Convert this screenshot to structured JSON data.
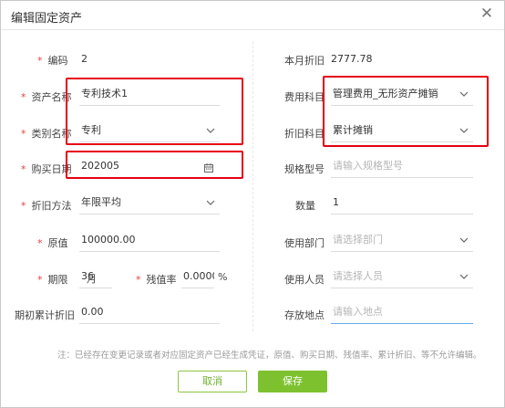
{
  "dialog": {
    "title": "编辑固定资产",
    "close_icon": "close-icon"
  },
  "left": {
    "code": {
      "label": "编码",
      "value": "2",
      "required": "*"
    },
    "asset_name": {
      "label": "资产名称",
      "value": "专利技术1",
      "required": "*"
    },
    "category": {
      "label": "类别名称",
      "value": "专利",
      "required": "*"
    },
    "purchase_date": {
      "label": "购买日期",
      "value": "202005",
      "required": "*"
    },
    "depreciation_method": {
      "label": "折旧方法",
      "value": "年限平均",
      "required": "*"
    },
    "original_value": {
      "label": "原值",
      "value": "100000.00",
      "required": "*"
    },
    "period": {
      "label": "期限",
      "value": "36",
      "unit": "月",
      "required": "*"
    },
    "residual_rate": {
      "label": "残值率",
      "value": "0.0000",
      "unit": "%",
      "required": "*"
    },
    "initial_accumulated": {
      "label": "期初累计折旧",
      "value": "0.00"
    }
  },
  "right": {
    "monthly_depreciation": {
      "label": "本月折旧",
      "value": "2777.78"
    },
    "expense_account": {
      "label": "费用科目",
      "value": "管理费用_无形资产摊销"
    },
    "depreciation_account": {
      "label": "折旧科目",
      "value": "累计摊销"
    },
    "spec_model": {
      "label": "规格型号",
      "placeholder": "请输入规格型号"
    },
    "quantity": {
      "label": "数量",
      "value": "1"
    },
    "department": {
      "label": "使用部门",
      "placeholder": "请选择部门"
    },
    "user": {
      "label": "使用人员",
      "placeholder": "请选择人员"
    },
    "location": {
      "label": "存放地点",
      "placeholder": "请输入地点"
    }
  },
  "note": "注：已经存在变更记录或者对应固定资产已经生成凭证，原值、购买日期、残值率、累计折旧、等不允许编辑。",
  "buttons": {
    "cancel": "取消",
    "save": "保存"
  },
  "colors": {
    "required": "#e84040",
    "accent_green": "#7dc22e",
    "highlight_red": "#e60012"
  }
}
